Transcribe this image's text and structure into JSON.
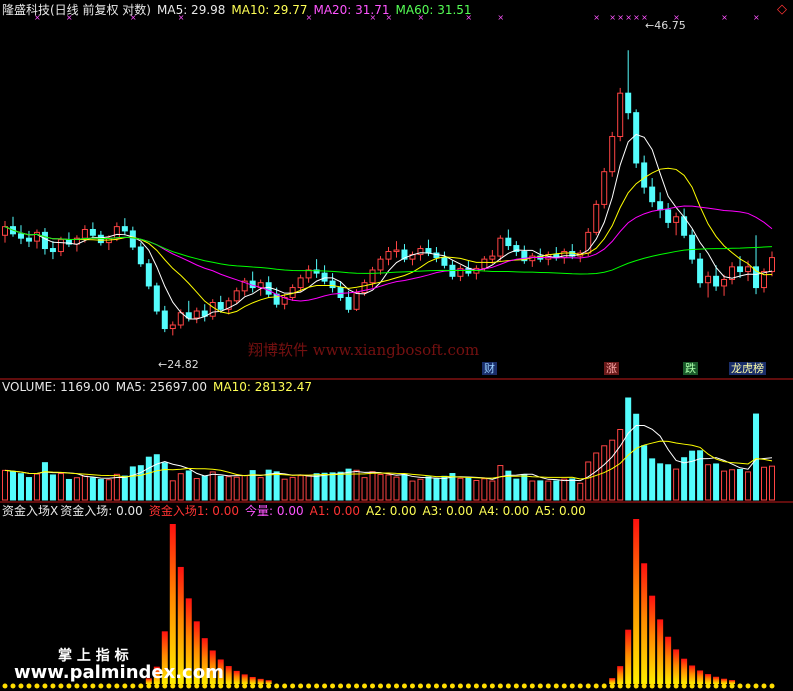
{
  "main_header": {
    "title": "隆盛科技(日线 前复权 对数)",
    "ma5": "MA5: 29.98",
    "ma10": "MA10: 29.77",
    "ma20": "MA20: 31.71",
    "ma60": "MA60: 31.51",
    "colors": {
      "ma5": "#ffffff",
      "ma10": "#ffff00",
      "ma20": "#ff00ff",
      "ma60": "#00ff00"
    }
  },
  "markers": {
    "high": "46.75",
    "low": "24.82"
  },
  "event_badges": [
    "财",
    "涨",
    "跌",
    "龙虎榜"
  ],
  "volume_header": {
    "label": "VOLUME: 1169.00",
    "ma5": "MA5: 25697.00",
    "ma10": "MA10: 28132.47"
  },
  "indicator_header": {
    "name": "资金入场X",
    "line1": "资金入场: 0.00",
    "line2": "资金入场1: 0.00",
    "line3": "今量: 0.00",
    "a1": "A1: 0.00",
    "a2": "A2: 0.00",
    "a3": "A3: 0.00",
    "a4": "A4: 0.00",
    "a5": "A5: 0.00"
  },
  "watermark": "翔博软件 www.xiangbosoft.com",
  "logo": {
    "line1": "掌 上 指 标",
    "line2": "www.palmindex.com"
  },
  "chart_data": [
    {
      "type": "candlestick",
      "title": "隆盛科技(日线 前复权 对数)",
      "ylim": [
        23.5,
        50
      ],
      "y_scale": "log",
      "annotations": {
        "max": 46.75,
        "min": 24.82
      },
      "candles": [
        [
          31.0,
          32.0,
          30.5,
          31.6
        ],
        [
          31.6,
          32.3,
          30.9,
          31.1
        ],
        [
          31.1,
          31.7,
          30.4,
          30.8
        ],
        [
          30.8,
          31.3,
          30.2,
          30.6
        ],
        [
          30.6,
          31.4,
          30.1,
          31.2
        ],
        [
          31.2,
          31.5,
          29.7,
          30.1
        ],
        [
          30.1,
          30.6,
          29.4,
          29.9
        ],
        [
          29.9,
          30.9,
          29.6,
          30.7
        ],
        [
          30.7,
          31.2,
          30.2,
          30.4
        ],
        [
          30.4,
          31.0,
          29.9,
          30.8
        ],
        [
          30.8,
          31.7,
          30.5,
          31.4
        ],
        [
          31.4,
          31.9,
          30.8,
          31.0
        ],
        [
          31.0,
          31.3,
          30.3,
          30.5
        ],
        [
          30.5,
          31.0,
          30.0,
          30.8
        ],
        [
          30.8,
          31.9,
          30.6,
          31.6
        ],
        [
          31.6,
          32.2,
          31.0,
          31.3
        ],
        [
          31.3,
          31.6,
          30.0,
          30.2
        ],
        [
          30.2,
          30.5,
          28.9,
          29.1
        ],
        [
          29.1,
          29.4,
          27.5,
          27.7
        ],
        [
          27.7,
          27.9,
          26.0,
          26.2
        ],
        [
          26.2,
          26.5,
          25.0,
          25.2
        ],
        [
          25.2,
          25.6,
          24.82,
          25.4
        ],
        [
          25.4,
          26.3,
          25.2,
          26.1
        ],
        [
          26.1,
          26.8,
          25.6,
          25.8
        ],
        [
          25.8,
          26.4,
          25.5,
          26.2
        ],
        [
          26.2,
          26.6,
          25.6,
          25.9
        ],
        [
          25.9,
          26.9,
          25.7,
          26.7
        ],
        [
          26.7,
          27.1,
          26.1,
          26.3
        ],
        [
          26.3,
          27.0,
          26.0,
          26.8
        ],
        [
          26.8,
          27.6,
          26.6,
          27.4
        ],
        [
          27.4,
          28.2,
          27.1,
          28.0
        ],
        [
          28.0,
          28.6,
          27.3,
          27.6
        ],
        [
          27.6,
          28.1,
          27.1,
          27.9
        ],
        [
          27.9,
          28.3,
          27.0,
          27.2
        ],
        [
          27.2,
          27.6,
          26.4,
          26.6
        ],
        [
          26.6,
          27.2,
          26.3,
          27.0
        ],
        [
          27.0,
          27.8,
          26.8,
          27.6
        ],
        [
          27.6,
          28.4,
          27.3,
          28.2
        ],
        [
          28.2,
          29.0,
          27.9,
          28.7
        ],
        [
          28.7,
          29.4,
          28.2,
          28.5
        ],
        [
          28.5,
          29.0,
          27.8,
          28.0
        ],
        [
          28.0,
          28.5,
          27.3,
          27.6
        ],
        [
          27.6,
          28.0,
          26.8,
          27.0
        ],
        [
          27.0,
          27.4,
          26.1,
          26.3
        ],
        [
          26.3,
          27.5,
          26.2,
          27.3
        ],
        [
          27.3,
          28.1,
          27.1,
          27.9
        ],
        [
          27.9,
          28.9,
          27.6,
          28.7
        ],
        [
          28.7,
          29.6,
          28.4,
          29.4
        ],
        [
          29.4,
          30.2,
          29.0,
          29.9
        ],
        [
          29.9,
          30.6,
          29.5,
          30.0
        ],
        [
          30.0,
          30.4,
          29.2,
          29.4
        ],
        [
          29.4,
          29.9,
          29.0,
          29.7
        ],
        [
          29.7,
          30.3,
          29.3,
          30.1
        ],
        [
          30.1,
          30.7,
          29.6,
          29.8
        ],
        [
          29.8,
          30.2,
          29.2,
          29.5
        ],
        [
          29.5,
          29.9,
          28.8,
          29.0
        ],
        [
          29.0,
          29.3,
          28.1,
          28.3
        ],
        [
          28.3,
          29.0,
          28.0,
          28.8
        ],
        [
          28.8,
          29.3,
          28.3,
          28.5
        ],
        [
          28.5,
          29.0,
          28.1,
          28.8
        ],
        [
          28.8,
          29.6,
          28.6,
          29.4
        ],
        [
          29.4,
          30.0,
          29.1,
          29.6
        ],
        [
          29.6,
          31.0,
          29.3,
          30.8
        ],
        [
          30.8,
          31.4,
          30.0,
          30.3
        ],
        [
          30.3,
          30.6,
          29.6,
          29.9
        ],
        [
          29.9,
          30.3,
          29.1,
          29.3
        ],
        [
          29.3,
          29.8,
          28.9,
          29.6
        ],
        [
          29.6,
          30.1,
          29.2,
          29.4
        ],
        [
          29.4,
          29.9,
          29.0,
          29.7
        ],
        [
          29.7,
          30.2,
          29.3,
          29.5
        ],
        [
          29.5,
          30.1,
          29.1,
          29.9
        ],
        [
          29.9,
          30.4,
          29.4,
          29.6
        ],
        [
          29.6,
          30.0,
          29.2,
          29.8
        ],
        [
          29.8,
          31.5,
          29.6,
          31.2
        ],
        [
          31.2,
          33.5,
          31.0,
          33.2
        ],
        [
          33.2,
          36.0,
          32.9,
          35.7
        ],
        [
          35.7,
          39.0,
          35.3,
          38.6
        ],
        [
          38.6,
          43.0,
          38.2,
          42.5
        ],
        [
          42.5,
          46.75,
          40.1,
          40.7
        ],
        [
          40.7,
          41.0,
          36.0,
          36.4
        ],
        [
          36.4,
          37.0,
          34.0,
          34.5
        ],
        [
          34.5,
          35.2,
          33.0,
          33.4
        ],
        [
          33.4,
          34.1,
          32.2,
          32.8
        ],
        [
          32.8,
          33.3,
          31.5,
          31.9
        ],
        [
          31.9,
          32.6,
          31.0,
          32.3
        ],
        [
          32.3,
          32.9,
          30.8,
          31.0
        ],
        [
          31.0,
          31.4,
          29.1,
          29.4
        ],
        [
          29.4,
          29.8,
          27.6,
          27.9
        ],
        [
          27.9,
          28.6,
          27.0,
          28.3
        ],
        [
          28.3,
          29.0,
          27.4,
          27.7
        ],
        [
          27.7,
          28.4,
          27.1,
          28.1
        ],
        [
          28.1,
          29.2,
          27.8,
          28.9
        ],
        [
          28.9,
          29.6,
          28.2,
          28.6
        ],
        [
          28.6,
          29.3,
          28.0,
          28.9
        ],
        [
          28.9,
          31.0,
          27.2,
          27.6
        ],
        [
          27.6,
          28.8,
          27.3,
          28.6
        ],
        [
          28.6,
          29.9,
          28.3,
          29.5
        ]
      ]
    },
    {
      "type": "bar",
      "title": "VOLUME",
      "values": [
        1169.0
      ],
      "ma5": 25697.0,
      "ma10": 28132.47
    },
    {
      "type": "bar",
      "title": "资金入场X",
      "series": [
        {
          "name": "资金入场",
          "values": [
            0.0
          ]
        },
        {
          "name": "资金入场1",
          "values": [
            0.0
          ]
        },
        {
          "name": "今量",
          "values": [
            0.0
          ]
        },
        {
          "name": "A1",
          "values": [
            0.0
          ]
        },
        {
          "name": "A2",
          "values": [
            0.0
          ]
        },
        {
          "name": "A3",
          "values": [
            0.0
          ]
        },
        {
          "name": "A4",
          "values": [
            0.0
          ]
        },
        {
          "name": "A5",
          "values": [
            0.0
          ]
        }
      ]
    }
  ]
}
